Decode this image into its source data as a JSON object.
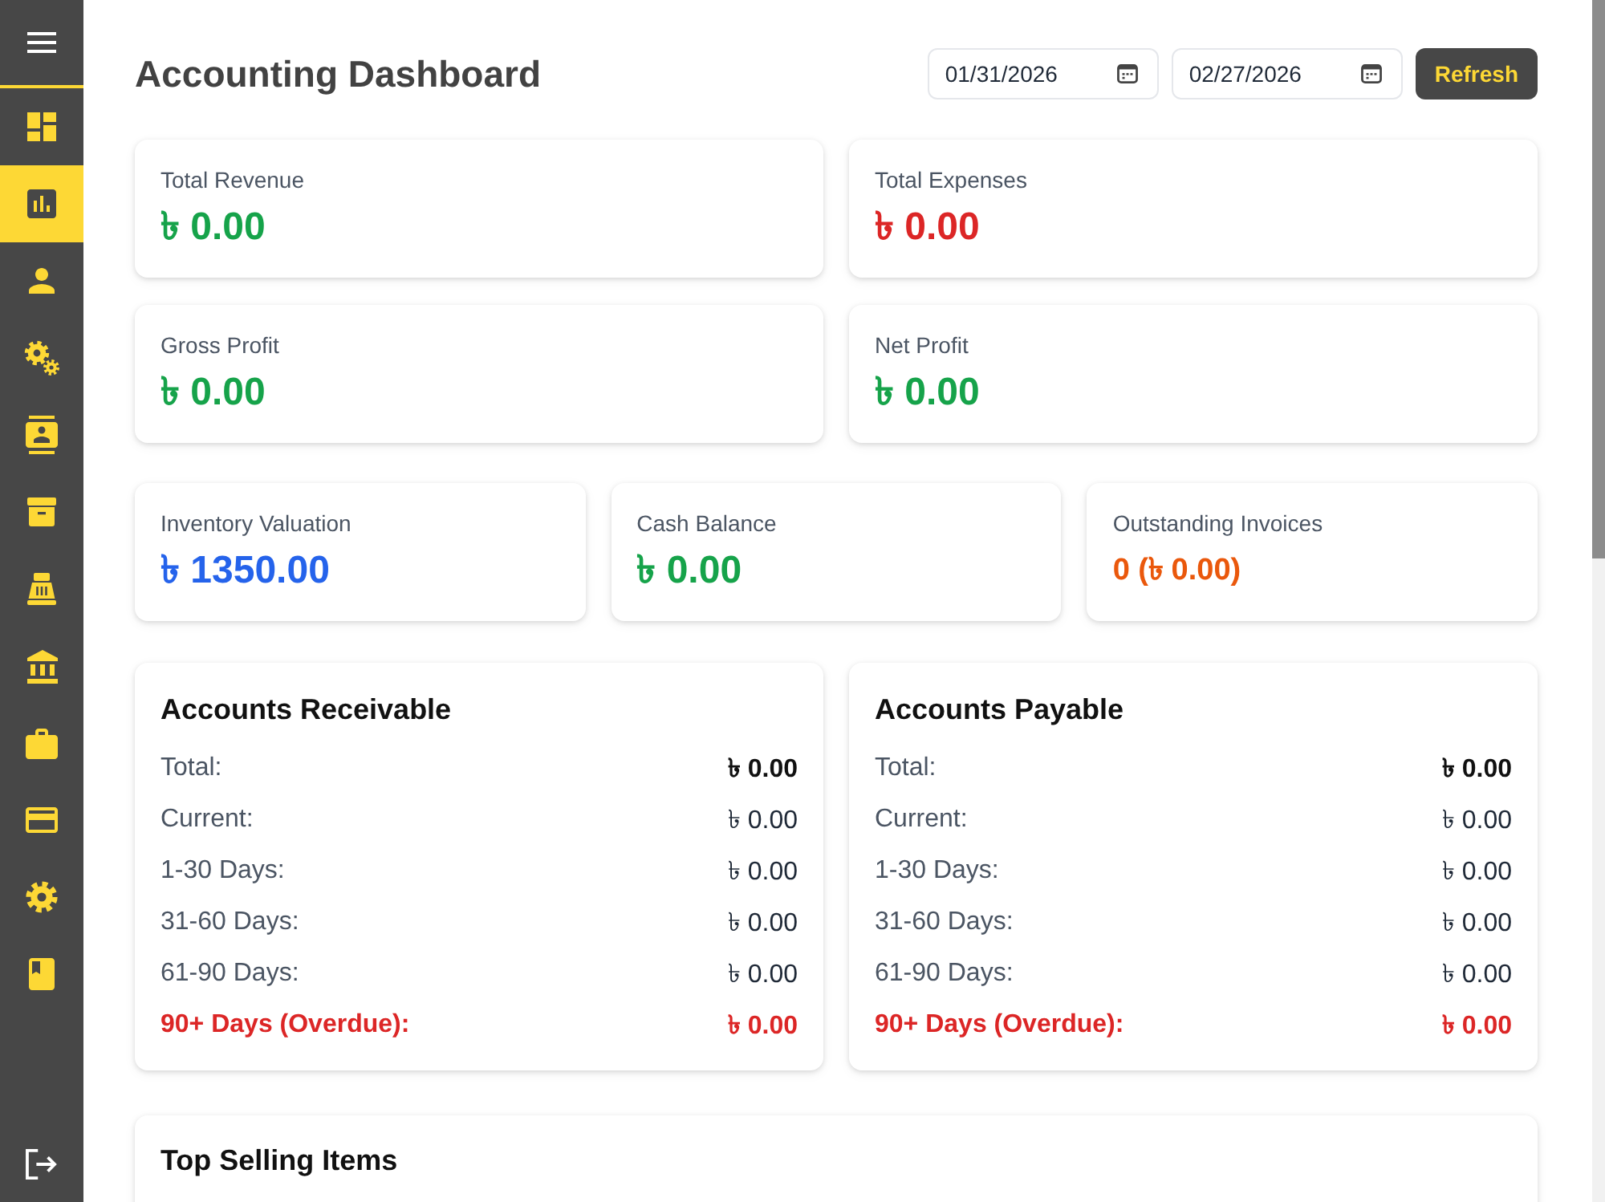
{
  "sidebar": {
    "items": [
      {
        "selected": false
      },
      {
        "selected": true
      },
      {
        "selected": false
      },
      {
        "selected": false
      },
      {
        "selected": false
      },
      {
        "selected": false
      },
      {
        "selected": false
      },
      {
        "selected": false
      },
      {
        "selected": false
      },
      {
        "selected": false
      },
      {
        "selected": false
      },
      {
        "selected": false
      }
    ]
  },
  "header": {
    "title": "Accounting Dashboard",
    "start_date": {
      "value": "01/31/2026"
    },
    "end_date": {
      "value": "02/27/2026"
    },
    "refresh_button": "Refresh"
  },
  "summary_rows": [
    {
      "cards": [
        {
          "label": "Total Revenue",
          "value": "৳ 0.00",
          "color": "#16a34a",
          "kind": "amount"
        },
        {
          "label": "Total Expenses",
          "value": "৳ 0.00",
          "color": "#dc2626",
          "kind": "amount"
        }
      ]
    },
    {
      "cards": [
        {
          "label": "Gross Profit",
          "value": "৳ 0.00",
          "color": "#16a34a",
          "kind": "amount"
        },
        {
          "label": "Net Profit",
          "value": "৳ 0.00",
          "color": "#16a34a",
          "kind": "amount"
        }
      ]
    },
    {
      "cards": [
        {
          "label": "Inventory Valuation",
          "value": "৳ 1350.00",
          "color": "#2563eb",
          "kind": "amount"
        },
        {
          "label": "Cash Balance",
          "value": "৳ 0.00",
          "color": "#16a34a",
          "kind": "amount"
        },
        {
          "label": "Outstanding Invoices",
          "value": "0 (৳ 0.00)",
          "color": "#ea580c",
          "kind": "count"
        }
      ]
    }
  ],
  "aging_cards": [
    {
      "title": "Accounts Receivable",
      "rows": [
        {
          "label": "Total:",
          "value": "৳ 0.00",
          "kind": "total"
        },
        {
          "label": "Current:",
          "value": "৳ 0.00",
          "kind": "normal"
        },
        {
          "label": "1-30 Days:",
          "value": "৳ 0.00",
          "kind": "normal"
        },
        {
          "label": "31-60 Days:",
          "value": "৳ 0.00",
          "kind": "normal"
        },
        {
          "label": "61-90 Days:",
          "value": "৳ 0.00",
          "kind": "normal"
        },
        {
          "label": "90+ Days (Overdue):",
          "value": "৳ 0.00",
          "kind": "overdue"
        }
      ]
    },
    {
      "title": "Accounts Payable",
      "rows": [
        {
          "label": "Total:",
          "value": "৳ 0.00",
          "kind": "total"
        },
        {
          "label": "Current:",
          "value": "৳ 0.00",
          "kind": "normal"
        },
        {
          "label": "1-30 Days:",
          "value": "৳ 0.00",
          "kind": "normal"
        },
        {
          "label": "31-60 Days:",
          "value": "৳ 0.00",
          "kind": "normal"
        },
        {
          "label": "61-90 Days:",
          "value": "৳ 0.00",
          "kind": "normal"
        },
        {
          "label": "90+ Days (Overdue):",
          "value": "৳ 0.00",
          "kind": "overdue"
        }
      ]
    }
  ],
  "top_selling": {
    "title": "Top Selling Items"
  }
}
